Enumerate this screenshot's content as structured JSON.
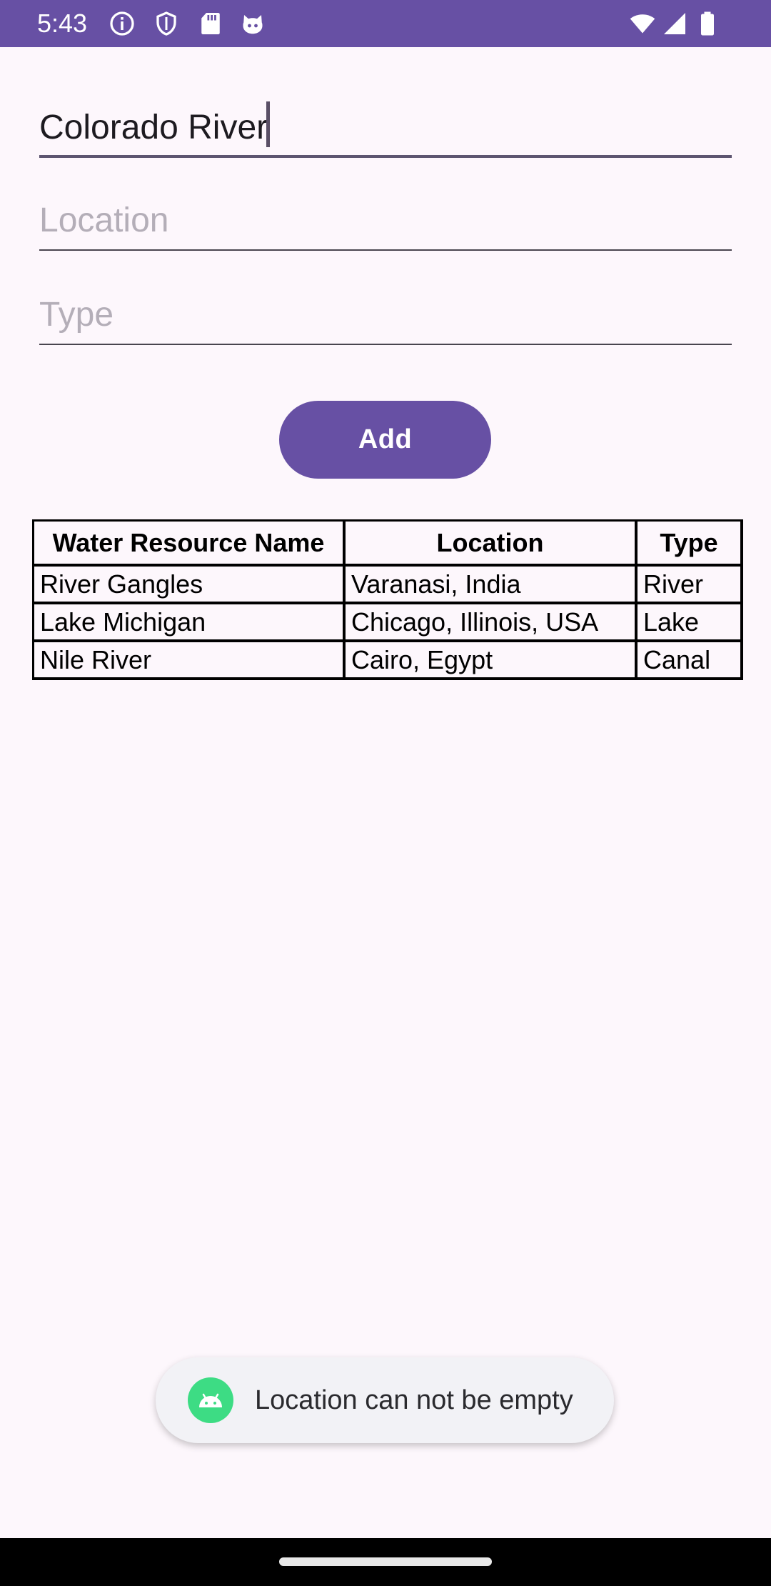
{
  "status_bar": {
    "time": "5:43",
    "left_icons": [
      "info-icon",
      "shield-icon",
      "sd-card-icon",
      "cat-face-icon"
    ],
    "right_icons": [
      "wifi-icon",
      "signal-icon",
      "battery-icon"
    ],
    "background_color": "#6750a4"
  },
  "form": {
    "name_field": {
      "value": "Colorado River",
      "placeholder": ""
    },
    "location_field": {
      "value": "",
      "placeholder": "Location"
    },
    "type_field": {
      "value": "",
      "placeholder": "Type"
    },
    "add_button_label": "Add",
    "accent_color": "#6750a4"
  },
  "table": {
    "headers": [
      "Water Resource Name",
      "Location",
      "Type"
    ],
    "rows": [
      [
        "River Gangles",
        "Varanasi, India",
        "River"
      ],
      [
        "Lake Michigan",
        "Chicago, Illinois, USA",
        "Lake"
      ],
      [
        "Nile River",
        "Cairo, Egypt",
        "Canal"
      ]
    ]
  },
  "toast": {
    "icon": "android-icon",
    "message": "Location can not be empty"
  }
}
